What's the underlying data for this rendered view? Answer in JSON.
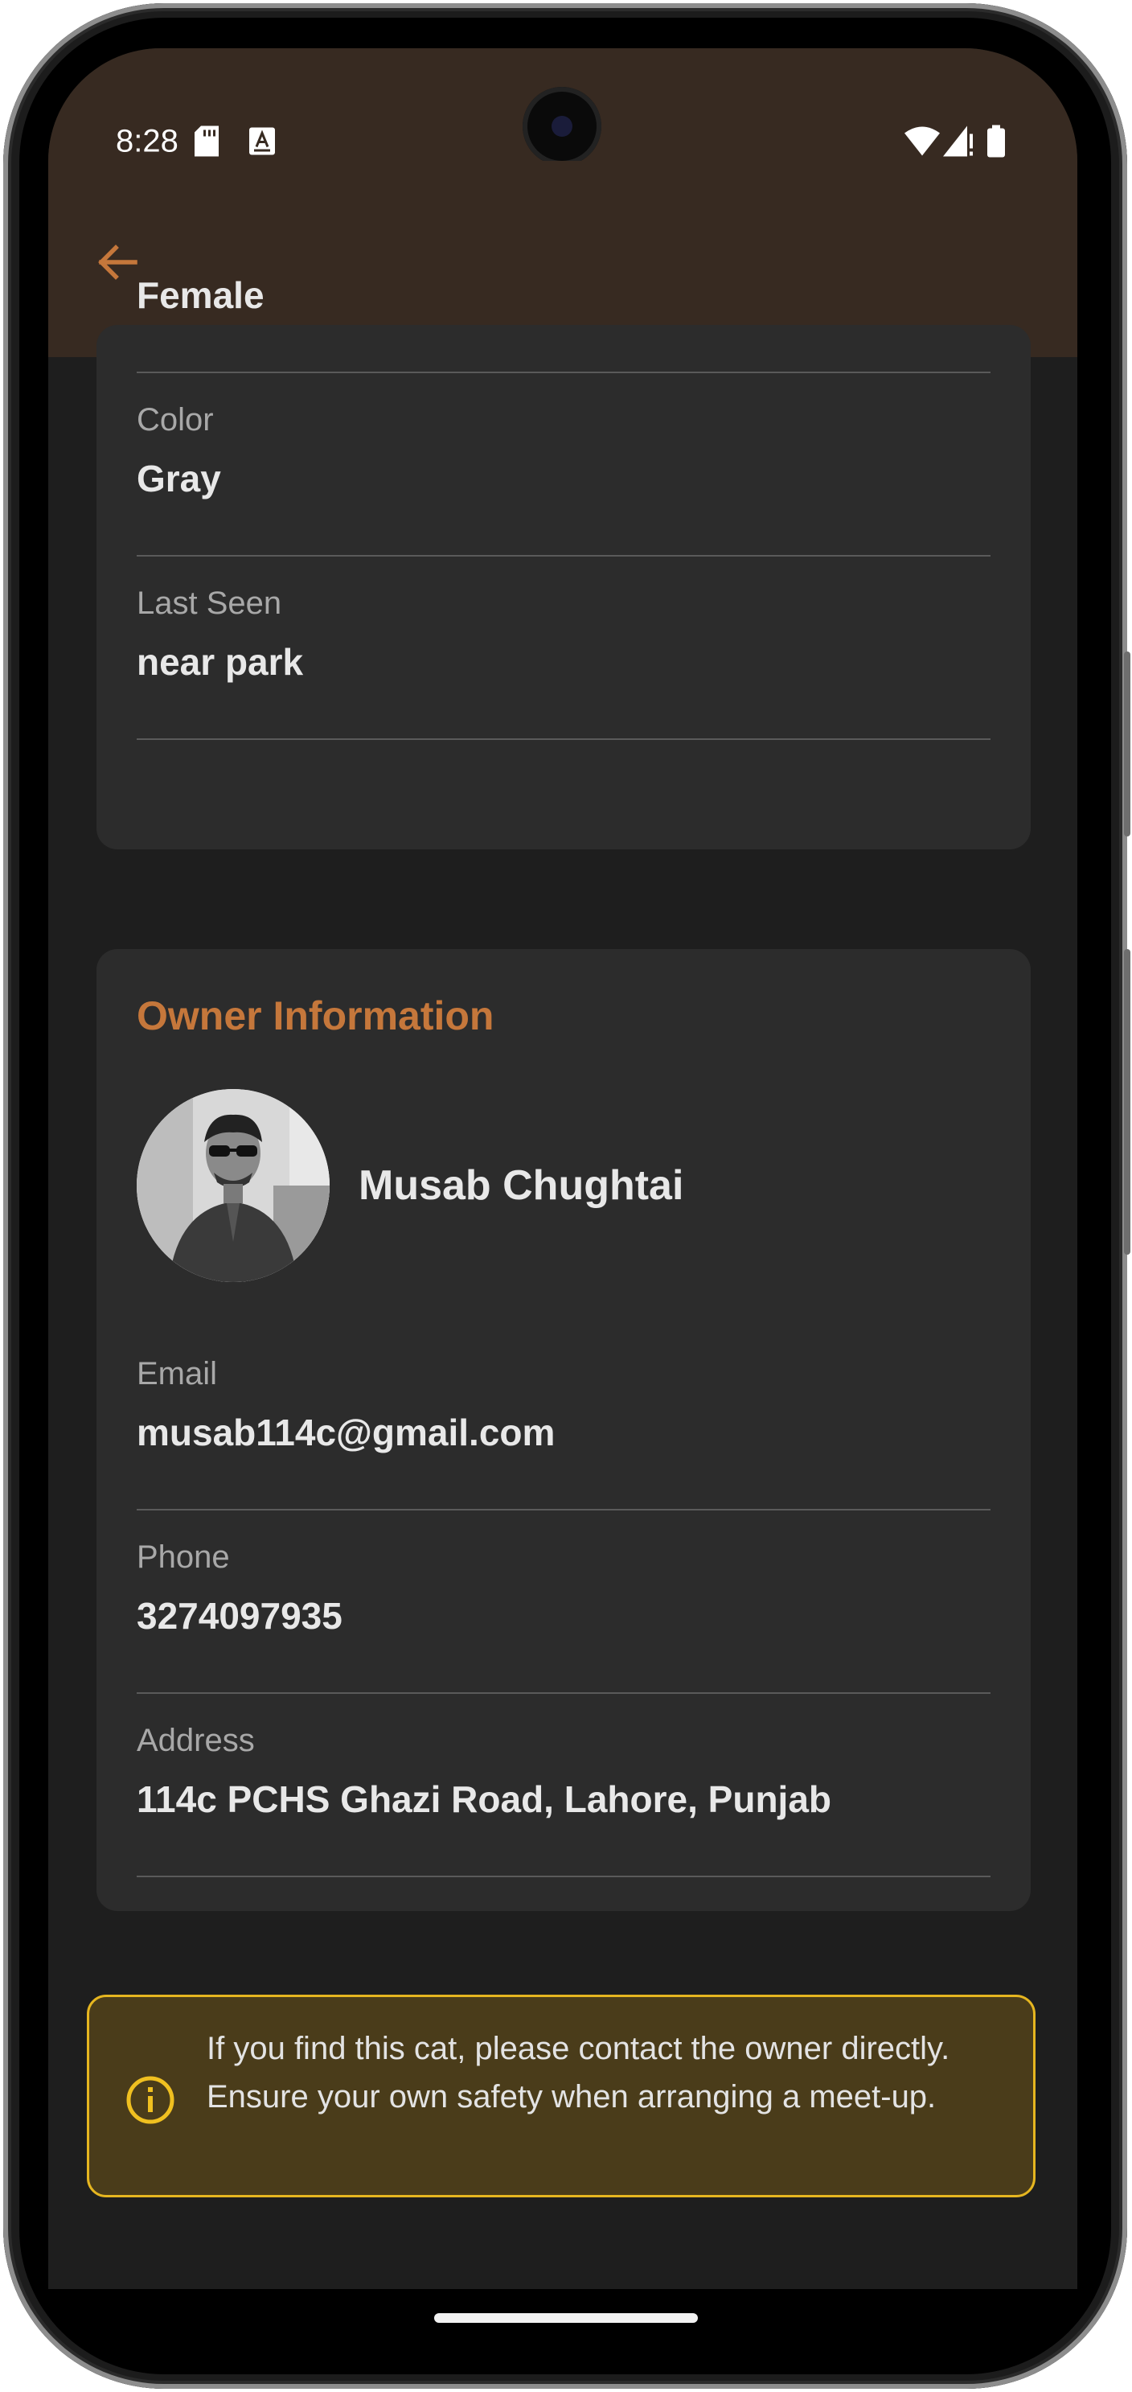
{
  "status_bar": {
    "time": "8:28"
  },
  "app_bar": {
    "back_icon": "arrow-left-icon",
    "accent_color": "#c5773b",
    "background_color": "#372a21"
  },
  "cat_details": {
    "gender_value": "Female",
    "color_label": "Color",
    "color_value": "Gray",
    "last_seen_label": "Last Seen",
    "last_seen_value": "near park"
  },
  "owner": {
    "section_title": "Owner Information",
    "name": "Musab Chughtai",
    "email_label": "Email",
    "email_value": "musab114c@gmail.com",
    "phone_label": "Phone",
    "phone_value": "3274097935",
    "address_label": "Address",
    "address_value": "114c PCHS Ghazi Road, Lahore, Punjab"
  },
  "notice": {
    "icon": "info-icon",
    "text": "If you find this cat, please contact the owner directly. Ensure your own safety when arranging a meet-up.",
    "border_color": "#e6b620",
    "background_color": "#4a3c1a"
  }
}
